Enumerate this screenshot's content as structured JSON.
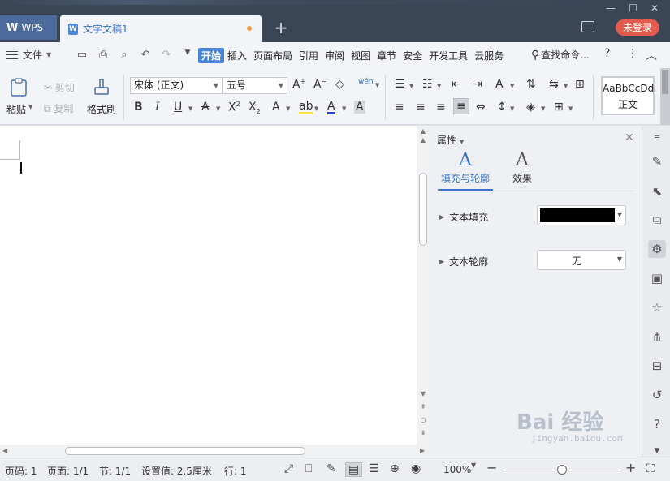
{
  "window": {
    "app_tab": "WPS",
    "doc_tab": "文字文稿1",
    "login_button": "未登录"
  },
  "menu": {
    "file": "文件",
    "items": [
      "开始",
      "插入",
      "页面布局",
      "引用",
      "审阅",
      "视图",
      "章节",
      "安全",
      "开发工具",
      "云服务"
    ],
    "active": "开始",
    "search": "查找命令...",
    "help": "?"
  },
  "ribbon": {
    "paste": "粘贴",
    "cut": "剪切",
    "copy": "复制",
    "format_painter": "格式刷",
    "font_name": "宋体 (正文)",
    "font_size": "五号",
    "pinyin": "wén",
    "style_sample": "AaBbCcDd",
    "style_name": "正文"
  },
  "panel": {
    "title": "属性",
    "tabs": [
      {
        "label": "填充与轮廓",
        "active": true
      },
      {
        "label": "效果",
        "active": false
      }
    ],
    "rows": [
      {
        "label": "文本填充",
        "value": ""
      },
      {
        "label": "文本轮廓",
        "value": "无"
      }
    ],
    "fill_color": "#000000"
  },
  "status": {
    "page_num": "页码: 1",
    "pages": "页面: 1/1",
    "section": "节: 1/1",
    "setting": "设置值: 2.5厘米",
    "row": "行: 1",
    "zoom": "100%",
    "zoom_fraction": 0.5
  },
  "watermark": {
    "main": "Bai  经验",
    "sub": "jingyan.baidu.com"
  },
  "colors": {
    "accent": "#4a86d8",
    "login": "#e35b4f",
    "titlebar": "#3a4656"
  }
}
